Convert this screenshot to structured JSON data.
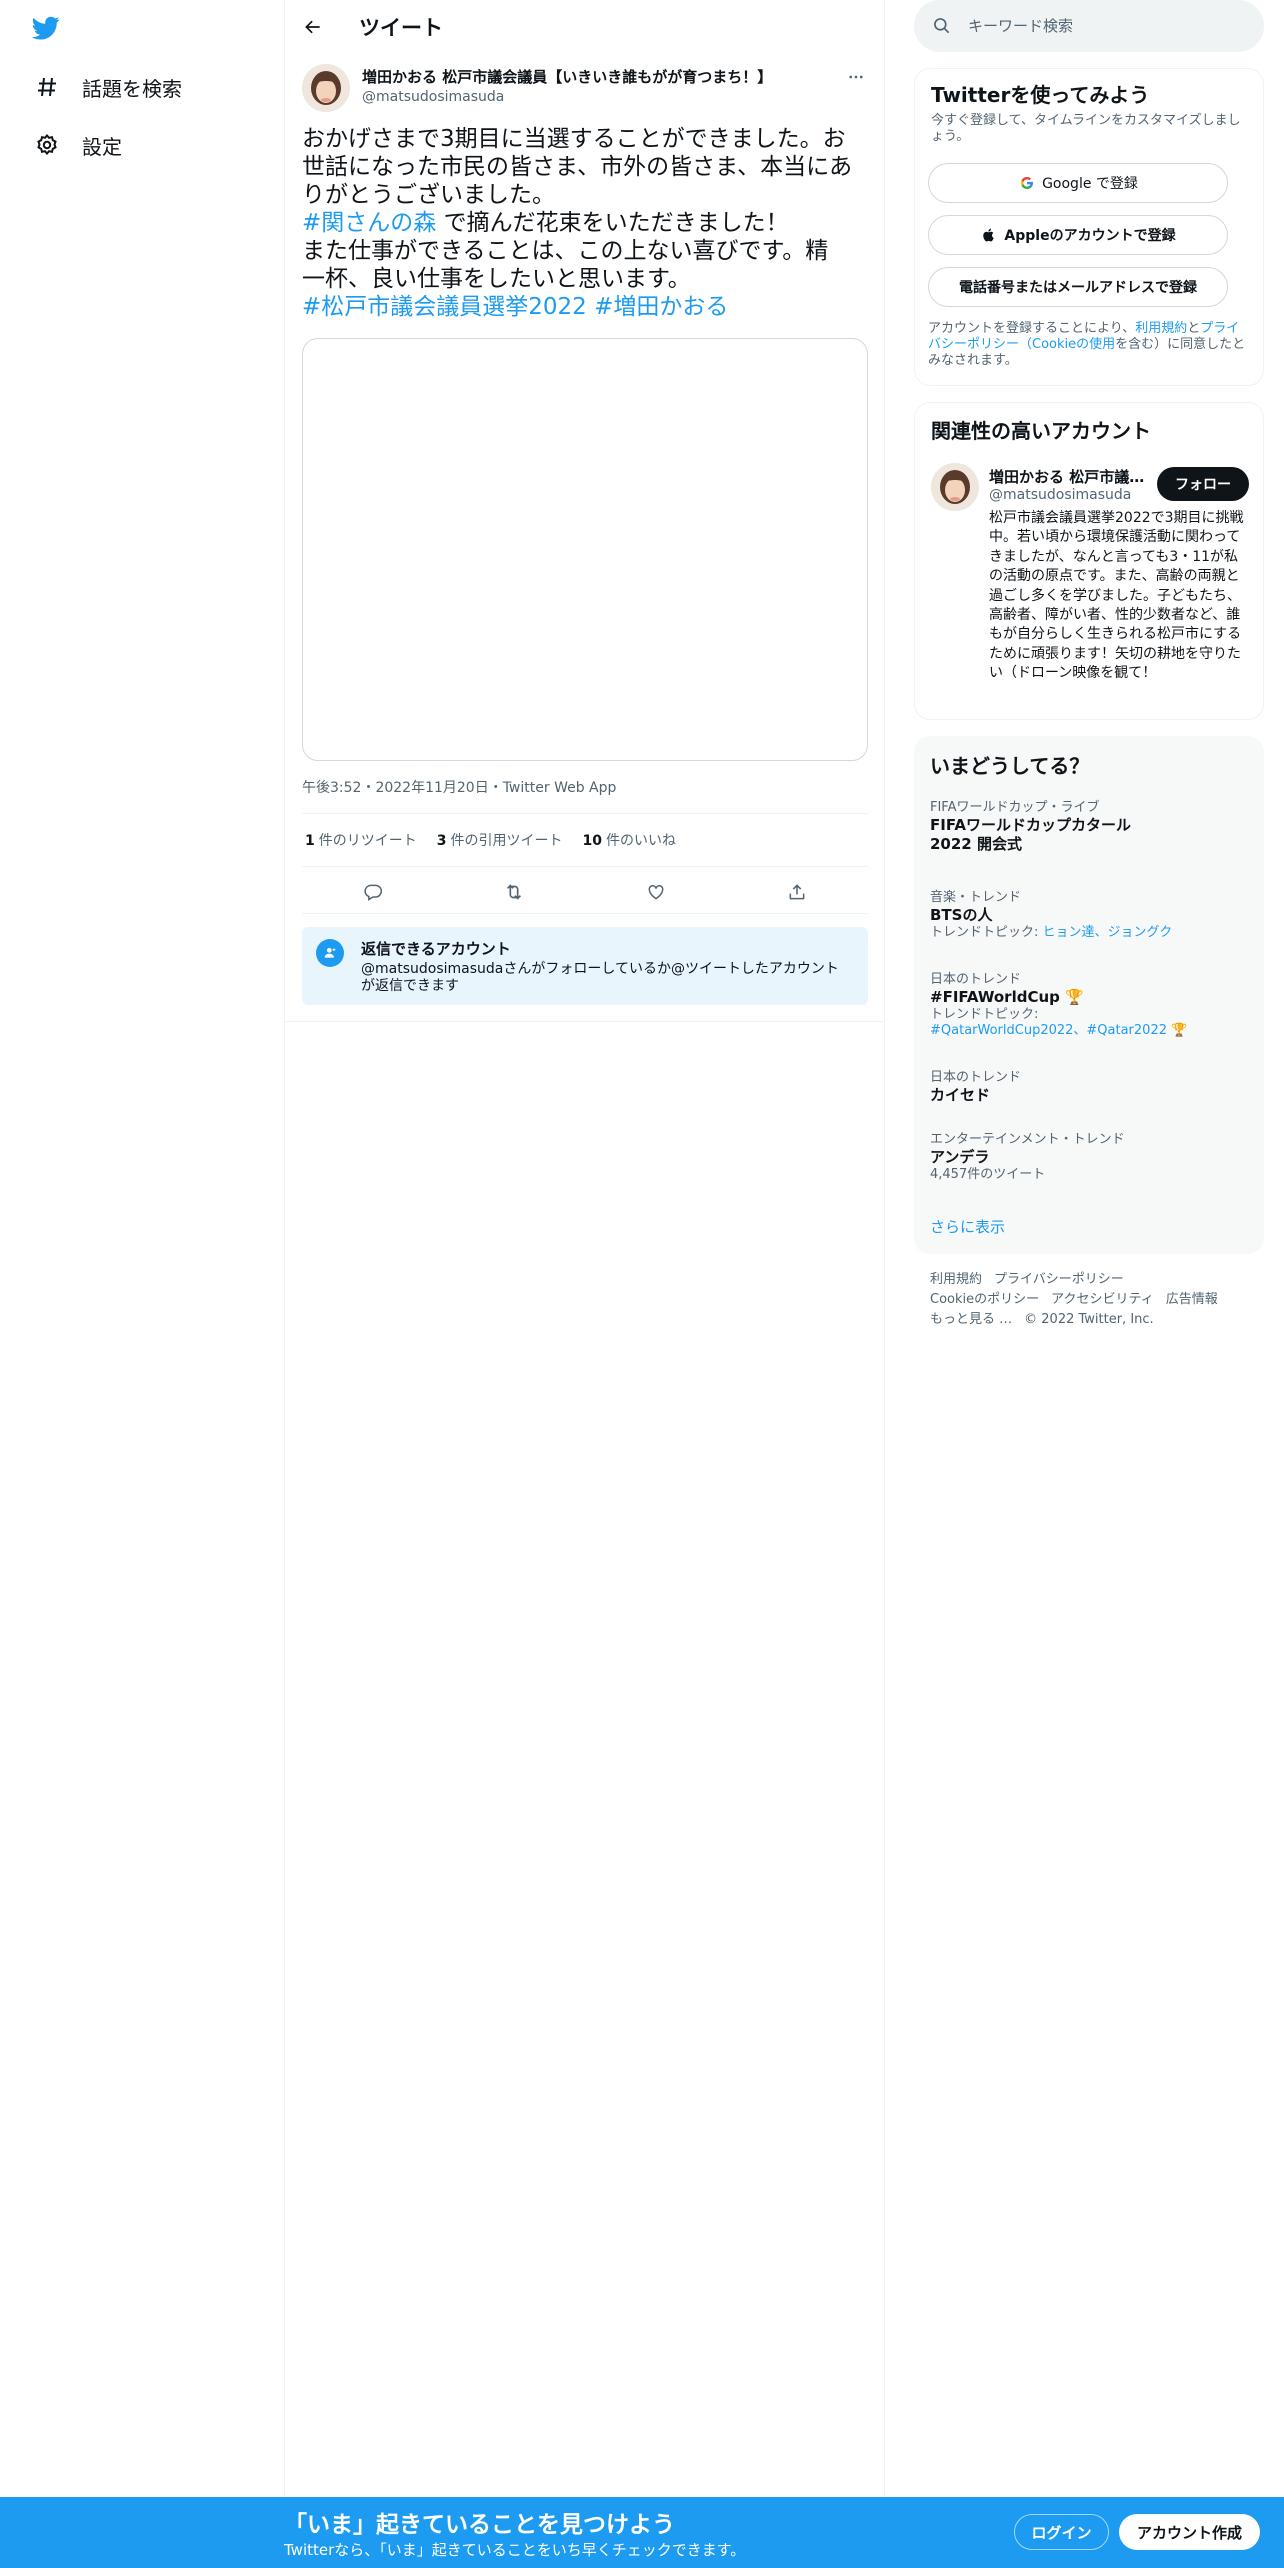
{
  "nav": {
    "items": [
      {
        "label": "話題を検索",
        "icon": "hashtag-icon"
      },
      {
        "label": "設定",
        "icon": "gear-icon"
      }
    ]
  },
  "header": {
    "title": "ツイート"
  },
  "tweet": {
    "name": "増田かおる 松戸市議会議員【いきいき誰もがが育つまち！】",
    "handle": "@matsudosimasuda",
    "lines": [
      [
        {
          "t": "おかげさまで3期目に当選することができました。お"
        }
      ],
      [
        {
          "t": "世話になった市民の皆さま、市外の皆さま、本当にあ"
        }
      ],
      [
        {
          "t": "りがとうございました。"
        }
      ],
      [
        {
          "t": "#関さんの森",
          "h": true
        },
        {
          "t": " で摘んだ花束をいただきました！"
        }
      ],
      [
        {
          "t": "また仕事ができることは、この上ない喜びです。精"
        }
      ],
      [
        {
          "t": "一杯、良い仕事をしたいと思います。"
        }
      ],
      [
        {
          "t": "#松戸市議会議員選挙2022",
          "h": true
        },
        {
          "t": " "
        },
        {
          "t": "#増田かおる",
          "h": true
        }
      ]
    ],
    "meta": "午後3:52・2022年11月20日・Twitter Web App",
    "stats": {
      "retweets": "1",
      "retweets_label": "件のリツイート",
      "quotes": "3",
      "quotes_label": "件の引用ツイート",
      "likes": "10",
      "likes_label": "件のいいね"
    },
    "reply_box": {
      "title": "返信できるアカウント",
      "desc": "@matsudosimasudaさんがフォローしているか@ツイートしたアカウントが返信できます"
    }
  },
  "sidebar": {
    "search_placeholder": "キーワード検索",
    "signup": {
      "title": "Twitterを使ってみよう",
      "subtitle": "今すぐ登録して、タイムラインをカスタマイズしましょう。",
      "google_label": "Google で登録",
      "apple_label": "Appleのアカウントで登録",
      "phone_label": "電話番号またはメールアドレスで登録",
      "terms_pre": "アカウントを登録することにより、",
      "terms_link1": "利用規約",
      "terms_mid": "と",
      "terms_link2": "プライバシーポリシー（Cookieの使用",
      "terms_post": "を含む）に同意したとみなされます。"
    },
    "related": {
      "title": "関連性の高いアカウント",
      "name": "増田かおる 松戸市議会議員【いきいき誰もがが育つまち！】",
      "handle": "@matsudosimasuda",
      "follow_label": "フォロー",
      "bio": "松戸市議会議員選挙2022で3期目に挑戦中。若い頃から環境保護活動に関わってきましたが、なんと言っても3・11が私の活動の原点です。また、高齢の両親と過ごし多くを学びました。子どもたち、高齢者、障がい者、性的少数者など、誰もが自分らしく生きられる松戸市にするために頑張ります！矢切の耕地を守りたい（ドローン映像を観て！"
    },
    "trends": {
      "title": "いまどうしてる？",
      "items": [
        {
          "cat": "FIFAワールドカップ・ライブ",
          "title": "FIFAワールドカップカタール2022 開会式"
        },
        {
          "cat": "音楽・トレンド",
          "title": "BTSの人",
          "extra_pre": "トレンドトピック: ",
          "extra_links": "ヒョン達、ジョングク"
        },
        {
          "cat": "日本のトレンド",
          "title": "#FIFAWorldCup",
          "extra_pre": "トレンドトピック:",
          "extra_links": "#QatarWorldCup2022、#Qatar2022"
        },
        {
          "cat": "日本のトレンド",
          "title": "カイセド"
        },
        {
          "cat": "エンターテインメント・トレンド",
          "title": "アンデラ",
          "extra_pre": "4,457件のツイート"
        }
      ],
      "show_more": "さらに表示"
    },
    "footer": {
      "links1": [
        "利用規約",
        "プライバシーポリシー"
      ],
      "links2": [
        "Cookieのポリシー",
        "アクセシビリティ",
        "広告情報"
      ],
      "more": "もっと見る …",
      "copyright": "© 2022 Twitter, Inc."
    }
  },
  "banner": {
    "title": "「いま」起きていることを見つけよう",
    "subtitle": "Twitterなら、「いま」起きていることをいち早くチェックできます。",
    "login": "ログイン",
    "signup": "アカウント作成"
  },
  "colors": {
    "accent": "#1d9bf0",
    "text": "#0f1419",
    "muted": "#536471"
  }
}
